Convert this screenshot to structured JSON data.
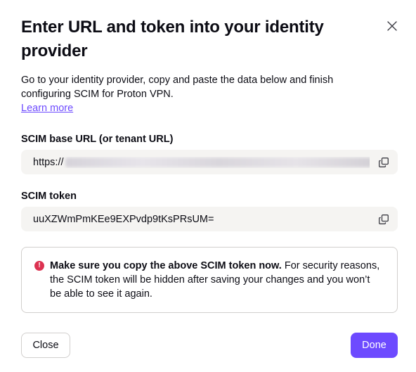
{
  "modal": {
    "title": "Enter URL and token into your identity provider",
    "description": "Go to your identity provider, copy and paste the data below and finish configuring SCIM for Proton VPN.",
    "learn_more": "Learn more"
  },
  "fields": {
    "base_url": {
      "label": "SCIM base URL (or tenant URL)",
      "value_prefix": "https://",
      "value_obscured": true
    },
    "token": {
      "label": "SCIM token",
      "value": "uuXZWmPmKEe9EXPvdp9tKsPRsUM="
    }
  },
  "notice": {
    "bold": "Make sure you copy the above SCIM token now.",
    "text": " For security reasons, the SCIM token will be hidden after saving your changes and you won’t be able to see it again."
  },
  "footer": {
    "close_label": "Close",
    "done_label": "Done"
  },
  "icons": {
    "close": "close-icon",
    "copy": "copy-icon",
    "warning": "exclamation-circle-icon"
  },
  "colors": {
    "accent": "#6d4aff",
    "danger": "#dc3251",
    "field_bg": "#f5f4f2",
    "border": "#d1cfcd"
  }
}
